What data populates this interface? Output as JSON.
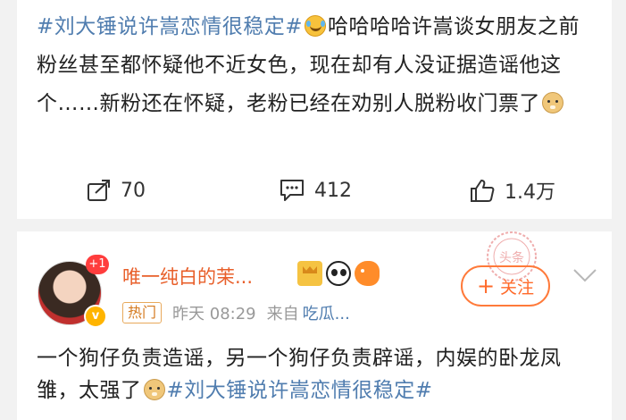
{
  "post1": {
    "hashtag": "#刘大锤说许嵩恋情很稳定#",
    "text_part1": "哈哈哈哈许嵩谈女朋友之前粉丝甚至都怀疑他不近女色，现在却有人没证据造谣他这个……新粉还在怀疑，老粉已经在劝别人脱粉收门票了",
    "emoji1": "laugh-emoji",
    "emoji2": "doge-emoji"
  },
  "actions": {
    "repost_count": "70",
    "comment_count": "412",
    "like_count": "1.4万"
  },
  "post2": {
    "avatar_badge": "+1",
    "vip_badge": "v",
    "username": "唯一纯白的茉...",
    "hot_tag": "热门",
    "time": "昨天 08:29",
    "from_label": "来自",
    "source": "吃瓜...",
    "follow_plus": "+",
    "follow_label": "关注",
    "text": "一个狗仔负责造谣，另一个狗仔负责辟谣，内娱的卧龙凤雏，太强了",
    "hashtag": "#刘大锤说许嵩恋情很稳定#",
    "stamp_text": "头条"
  },
  "colors": {
    "hashtag": "#507daf",
    "username": "#e85f2a",
    "follow": "#ff6a2a",
    "background": "#f2f2f2"
  }
}
